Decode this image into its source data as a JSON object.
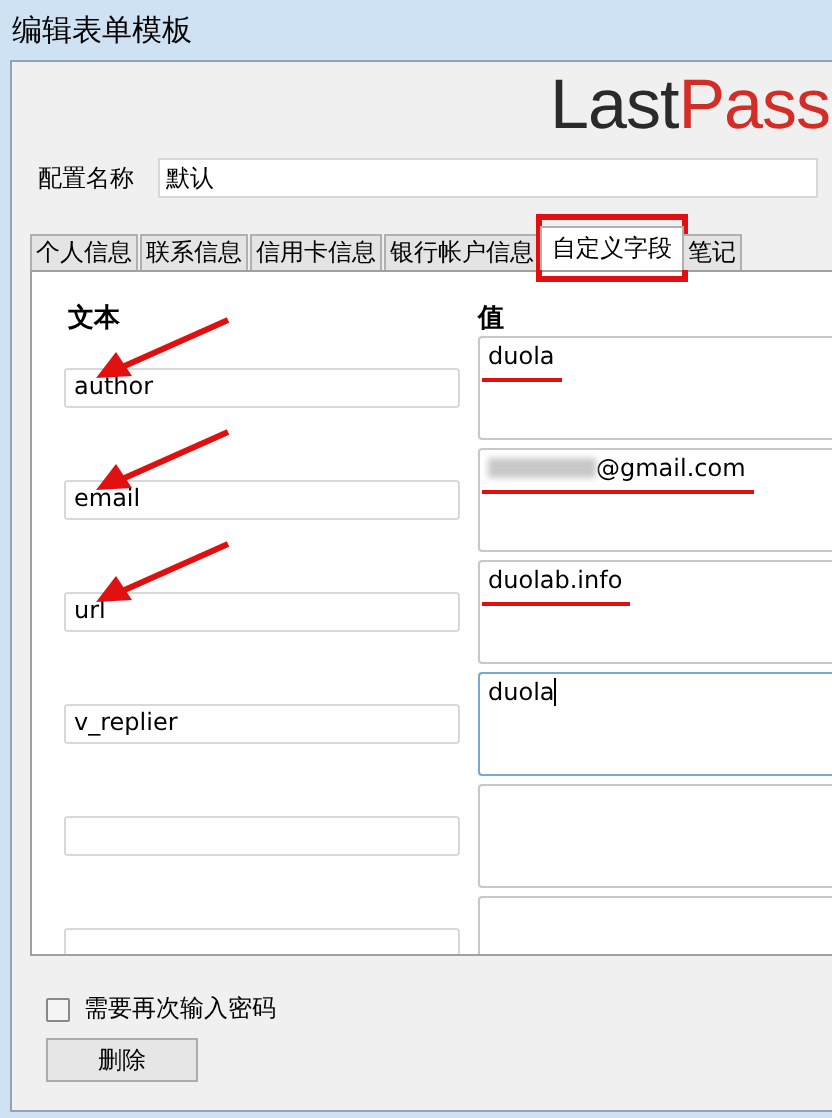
{
  "window": {
    "title": "编辑表单模板"
  },
  "logo": {
    "dark": "Last",
    "accent": "Pass"
  },
  "profile": {
    "label": "配置名称",
    "value": "默认"
  },
  "tabs": [
    {
      "label": "个人信息",
      "selected": false,
      "highlighted": false
    },
    {
      "label": "联系信息",
      "selected": false,
      "highlighted": false
    },
    {
      "label": "信用卡信息",
      "selected": false,
      "highlighted": false
    },
    {
      "label": "银行帐户信息",
      "selected": false,
      "highlighted": false
    },
    {
      "label": "自定义字段",
      "selected": true,
      "highlighted": true
    },
    {
      "label": "笔记",
      "selected": false,
      "highlighted": false
    }
  ],
  "columns": [
    "文本",
    "值"
  ],
  "rows": [
    {
      "name": "author",
      "value": "duola",
      "marked": true,
      "redacted": false,
      "focused": false
    },
    {
      "name": "email",
      "value": "@gmail.com",
      "marked": true,
      "redacted": true,
      "focused": false
    },
    {
      "name": "url",
      "value": "duolab.info",
      "marked": true,
      "redacted": false,
      "focused": false
    },
    {
      "name": "v_replier",
      "value": "duola",
      "marked": false,
      "redacted": false,
      "focused": true
    },
    {
      "marked": false,
      "redacted": false,
      "focused": false
    },
    {
      "marked": false,
      "redacted": false,
      "focused": false
    }
  ],
  "reprompt": {
    "label": "需要再次输入密码",
    "checked": false
  },
  "buttons": [
    "删除"
  ]
}
